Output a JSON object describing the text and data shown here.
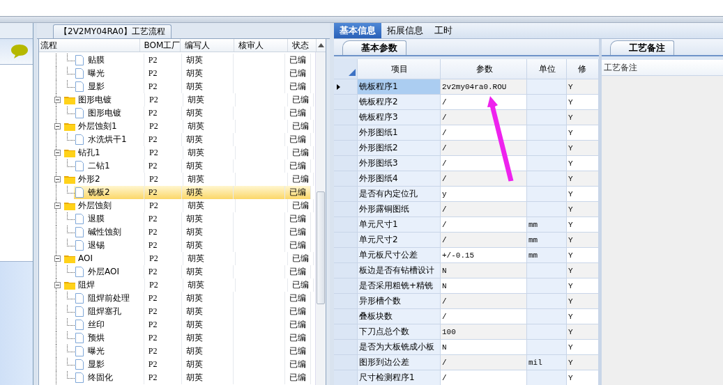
{
  "process_tree": {
    "tab_title": "【2V2MY04RA0】工艺流程",
    "columns": [
      "流程",
      "BOM工厂",
      "编写人",
      "核审人",
      "状态"
    ],
    "continued_steps": [
      {
        "name": "贴膜",
        "factory": "P2",
        "author": "胡英",
        "status": "已编",
        "selected": false
      },
      {
        "name": "曝光",
        "factory": "P2",
        "author": "胡英",
        "status": "已编",
        "selected": false
      },
      {
        "name": "显影",
        "factory": "P2",
        "author": "胡英",
        "status": "已编",
        "selected": false
      }
    ],
    "groups": [
      {
        "name": "图形电镀",
        "factory": "P2",
        "author": "胡英",
        "status": "已编",
        "selected": false,
        "expanded": true,
        "children": [
          {
            "name": "图形电镀",
            "factory": "P2",
            "author": "胡英",
            "status": "已编",
            "selected": false
          }
        ]
      },
      {
        "name": "外层蚀刻1",
        "factory": "P2",
        "author": "胡英",
        "status": "已编",
        "selected": false,
        "expanded": true,
        "children": [
          {
            "name": "水洗烘干1",
            "factory": "P2",
            "author": "胡英",
            "status": "已编",
            "selected": false
          }
        ]
      },
      {
        "name": "钻孔1",
        "factory": "P2",
        "author": "胡英",
        "status": "已编",
        "selected": false,
        "expanded": true,
        "children": [
          {
            "name": "二钻1",
            "factory": "P2",
            "author": "胡英",
            "status": "已编",
            "selected": false
          }
        ]
      },
      {
        "name": "外形2",
        "factory": "P2",
        "author": "胡英",
        "status": "已编",
        "selected": false,
        "expanded": true,
        "children": [
          {
            "name": "铣板2",
            "factory": "P2",
            "author": "胡英",
            "status": "已编",
            "selected": true
          }
        ]
      },
      {
        "name": "外层蚀刻",
        "factory": "P2",
        "author": "胡英",
        "status": "已编",
        "selected": false,
        "expanded": true,
        "children": [
          {
            "name": "退膜",
            "factory": "P2",
            "author": "胡英",
            "status": "已编",
            "selected": false
          },
          {
            "name": "碱性蚀刻",
            "factory": "P2",
            "author": "胡英",
            "status": "已编",
            "selected": false
          },
          {
            "name": "退锡",
            "factory": "P2",
            "author": "胡英",
            "status": "已编",
            "selected": false
          }
        ]
      },
      {
        "name": "AOI",
        "factory": "P2",
        "author": "胡英",
        "status": "已编",
        "selected": false,
        "expanded": true,
        "children": [
          {
            "name": "外层AOI",
            "factory": "P2",
            "author": "胡英",
            "status": "已编",
            "selected": false
          }
        ]
      },
      {
        "name": "阻焊",
        "factory": "P2",
        "author": "胡英",
        "status": "已编",
        "selected": false,
        "expanded": true,
        "children": [
          {
            "name": "阻焊前处理",
            "factory": "P2",
            "author": "胡英",
            "status": "已编",
            "selected": false
          },
          {
            "name": "阻焊塞孔",
            "factory": "P2",
            "author": "胡英",
            "status": "已编",
            "selected": false
          },
          {
            "name": "丝印",
            "factory": "P2",
            "author": "胡英",
            "status": "已编",
            "selected": false
          },
          {
            "name": "预烘",
            "factory": "P2",
            "author": "胡英",
            "status": "已编",
            "selected": false
          },
          {
            "name": "曝光",
            "factory": "P2",
            "author": "胡英",
            "status": "已编",
            "selected": false
          },
          {
            "name": "显影",
            "factory": "P2",
            "author": "胡英",
            "status": "已编",
            "selected": false
          },
          {
            "name": "终固化",
            "factory": "P2",
            "author": "胡英",
            "status": "已编",
            "selected": false
          }
        ]
      }
    ]
  },
  "tabs": [
    {
      "label": "基本信息",
      "selected": true
    },
    {
      "label": "拓展信息",
      "selected": false
    },
    {
      "label": "工时",
      "selected": false
    }
  ],
  "params": {
    "tab": "基本参数",
    "columns": [
      "项目",
      "参数",
      "单位",
      "修"
    ],
    "rows": [
      {
        "item": "铣板程序1",
        "value": "2v2my04ra0.ROU",
        "modify": "Y",
        "selected": true
      },
      {
        "item": "铣板程序2",
        "value": "/",
        "modify": "Y",
        "selected": false
      },
      {
        "item": "铣板程序3",
        "value": "/",
        "modify": "Y",
        "selected": false
      },
      {
        "item": "外形图纸1",
        "value": "/",
        "modify": "Y",
        "selected": false
      },
      {
        "item": "外形图纸2",
        "value": "/",
        "modify": "Y",
        "selected": false
      },
      {
        "item": "外形图纸3",
        "value": "/",
        "modify": "Y",
        "selected": false
      },
      {
        "item": "外形图纸4",
        "value": "/",
        "modify": "Y",
        "selected": false
      },
      {
        "item": "是否有内定位孔",
        "value": "y",
        "modify": "Y",
        "selected": false
      },
      {
        "item": "外形露铜图纸",
        "value": "/",
        "modify": "Y",
        "selected": false
      },
      {
        "item": "单元尺寸1",
        "value": "/",
        "unit": "mm",
        "modify": "Y",
        "selected": false
      },
      {
        "item": "单元尺寸2",
        "value": "/",
        "unit": "mm",
        "modify": "Y",
        "selected": false
      },
      {
        "item": "单元板尺寸公差",
        "value": "+/-0.15",
        "unit": "mm",
        "modify": "Y",
        "selected": false
      },
      {
        "item": "板边是否有钻槽设计",
        "value": "N",
        "modify": "Y",
        "selected": false
      },
      {
        "item": "是否采用粗铣+精铣",
        "value": "N",
        "modify": "Y",
        "selected": false
      },
      {
        "item": "异形槽个数",
        "value": "/",
        "modify": "Y",
        "selected": false
      },
      {
        "item": "叠板块数",
        "value": "/",
        "modify": "Y",
        "selected": false
      },
      {
        "item": "下刀点总个数",
        "value": "100",
        "modify": "Y",
        "selected": false
      },
      {
        "item": "是否为大板铣成小板",
        "value": "N",
        "modify": "Y",
        "selected": false
      },
      {
        "item": "图形到边公差",
        "value": "/",
        "unit": "mil",
        "modify": "Y",
        "selected": false
      },
      {
        "item": "尺寸检测程序1",
        "value": "/",
        "modify": "Y",
        "selected": false
      }
    ]
  },
  "notes": {
    "tab": "工艺备注",
    "header": "工艺备注"
  }
}
